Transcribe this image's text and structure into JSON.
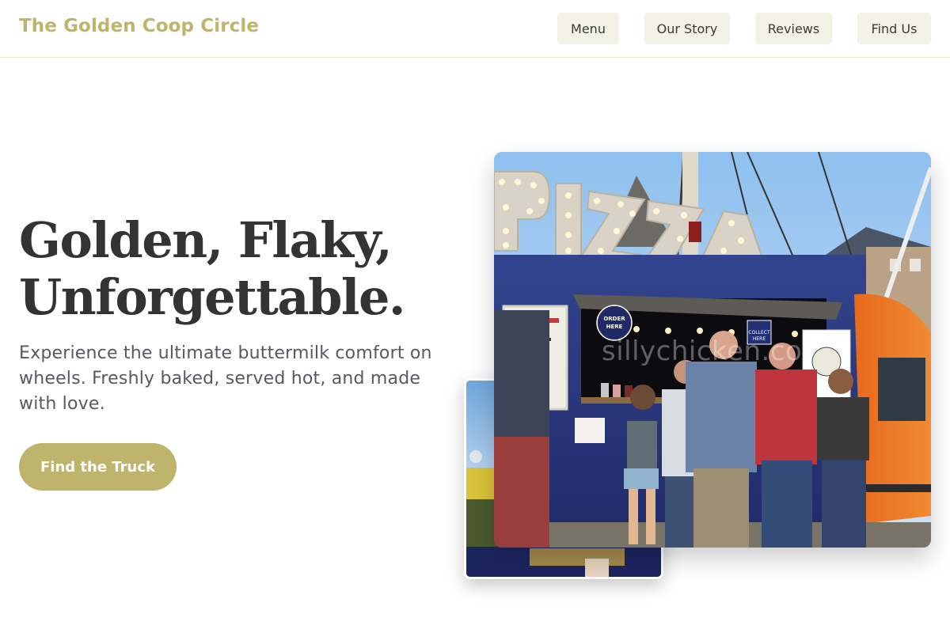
{
  "header": {
    "brand": "The Golden Coop Circle",
    "nav": [
      "Menu",
      "Our Story",
      "Reviews",
      "Find Us"
    ]
  },
  "hero": {
    "headline_line1": "Golden, Flaky,",
    "headline_line2": "Unforgettable.",
    "subtitle": "Experience the ultimate buttermilk comfort on wheels. Freshly baked, served hot, and made with love.",
    "cta_label": "Find the Truck"
  },
  "photo": {
    "sign_text": "PIZZA",
    "truck_sign_order": "ORDER HERE",
    "truck_sign_collect": "COLLECT HERE",
    "watermark": "sillychicken.co"
  },
  "colors": {
    "accent": "#bfb46b",
    "nav_bg": "#f3f2e7",
    "heading": "#333333",
    "body_text": "#555960"
  },
  "icons": []
}
